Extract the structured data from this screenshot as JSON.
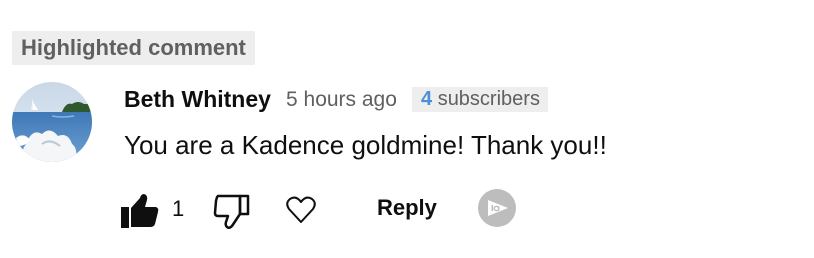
{
  "highlight": {
    "label": "Highlighted comment"
  },
  "comment": {
    "author": "Beth Whitney",
    "time": "5 hours ago",
    "subscribers_count": "4",
    "subscribers_label": "subscribers",
    "text": "You are a Kadence goldmine!  Thank you!!"
  },
  "actions": {
    "like_count": "1",
    "reply_label": "Reply",
    "icons": {
      "like": "thumbs-up-icon",
      "dislike": "thumbs-down-icon",
      "heart": "heart-icon",
      "extra": "ia-badge-icon"
    }
  },
  "colors": {
    "badge_bg": "#eeeeee",
    "text_primary": "#0f0f0f",
    "text_secondary": "#606060",
    "subscriber_count": "#4a90d9"
  }
}
